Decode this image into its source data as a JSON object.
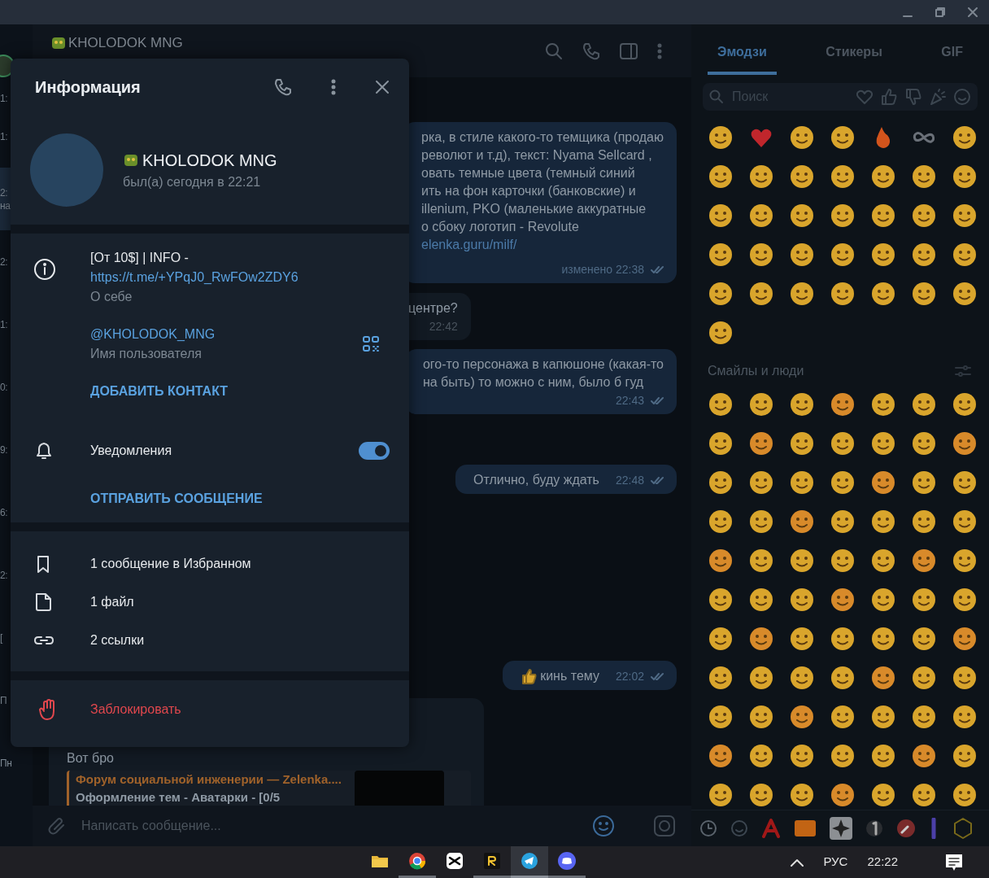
{
  "chat_list": {
    "items": [
      {
        "time": "1:",
        "selected": false
      },
      {
        "time": "1:",
        "selected": false
      },
      {
        "time": "2:",
        "preview": "на",
        "selected": true
      },
      {
        "time": "2:",
        "selected": false
      },
      {
        "time": "1:",
        "selected": false
      },
      {
        "time": "0:",
        "selected": false
      },
      {
        "time": "9:",
        "selected": false
      },
      {
        "time": "6:",
        "selected": false
      },
      {
        "time": "2:",
        "selected": false
      },
      {
        "preview": "[",
        "selected": false
      },
      {
        "preview": "П",
        "selected": false
      },
      {
        "time": "Пн",
        "selected": false
      }
    ]
  },
  "chat": {
    "header": {
      "title": "KHOLODOK MNG"
    },
    "messages": [
      {
        "kind": "outgoing",
        "lines": [
          "рка, в стиле какого-то темщика (продаю",
          "револют и т.д), текст: Nyama Sellcard ,",
          "овать темные цвета (темный синий",
          "ить на фон карточки (банковские) и",
          "illenium, PKO (маленькие аккуратные",
          "о сбоку логотип - Revolute"
        ],
        "link": "elenka.guru/milf/",
        "meta": "изменено 22:38",
        "read": true
      },
      {
        "kind": "incoming",
        "lines": [
          "центре?"
        ],
        "meta": "22:42"
      },
      {
        "kind": "outgoing",
        "lines": [
          "ого-то персонажа в капюшоне (какая-то",
          "на быть) то можно с ним, было б гуд"
        ],
        "meta": "22:43",
        "read": true
      },
      {
        "kind": "outgoing",
        "lines": [
          "Отлично, буду ждать"
        ],
        "meta": "22:48",
        "read": true
      },
      {
        "kind": "outgoing",
        "with_emoji": true,
        "lines": [
          "кинь тему"
        ],
        "meta": "22:02",
        "read": true
      },
      {
        "kind": "incoming",
        "lines": [
          "Вот бро"
        ],
        "preview": {
          "title": "Форум социальной инженерии —  Zelenka....",
          "subtitle": "Оформление тем - Аватарки - [0/5"
        }
      }
    ],
    "composer": {
      "placeholder": "Написать сообщение..."
    }
  },
  "profile_panel": {
    "title": "Информация",
    "name": "KHOLODOK MNG",
    "status": "был(а) сегодня в 22:21",
    "bio": "[От 10$] | INFO -",
    "bio_link": "https://t.me/+YPqJ0_RwFOw2ZDY6",
    "bio_label": "О себе",
    "username": "@KHOLODOK_MNG",
    "username_label": "Имя пользователя",
    "add_contact": "ДОБАВИТЬ КОНТАКТ",
    "notifications": {
      "label": "Уведомления",
      "on": true
    },
    "send_message": "ОТПРАВИТЬ СООБЩЕНИЕ",
    "media": [
      {
        "kind": "saved",
        "label": "1 сообщение в Избранном"
      },
      {
        "kind": "file",
        "label": "1 файл"
      },
      {
        "kind": "link",
        "label": "2 ссылки"
      }
    ],
    "block": "Заблокировать"
  },
  "emoji_panel": {
    "tabs": [
      {
        "label": "Эмодзи",
        "selected": true
      },
      {
        "label": "Стикеры",
        "selected": false
      },
      {
        "label": "GIF",
        "selected": false
      }
    ],
    "search": {
      "placeholder": "Поиск"
    },
    "section_label": "Смайлы и люди"
  },
  "taskbar": {
    "apps": [
      {
        "kind": "folder",
        "selected": false
      },
      {
        "kind": "browser",
        "selected": false
      },
      {
        "kind": "editor",
        "selected": false
      },
      {
        "kind": "r-app",
        "selected": false
      },
      {
        "kind": "messenger",
        "selected": true
      },
      {
        "kind": "voice-chat",
        "selected": false
      }
    ],
    "language": "РУС",
    "clock": "22:22"
  }
}
